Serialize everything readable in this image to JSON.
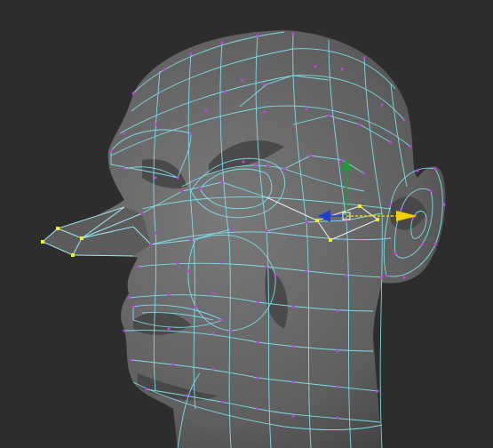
{
  "viewport": {
    "background_color": "#2d2d2d",
    "mesh_fill_color": "#6b6b6b",
    "mesh_shadow_color": "#3e3e3e",
    "wire_color": "#7fe3ef",
    "vertex_color": "#c040e0",
    "selected_vertex_color": "#f2ee22",
    "selected_edge_color": "#e8e8e8",
    "gizmo": {
      "x_axis_color": "#f0d000",
      "y_axis_color": "#1f9b3a",
      "z_axis_color": "#1f3fd0",
      "center_color": "#ffffff"
    }
  }
}
